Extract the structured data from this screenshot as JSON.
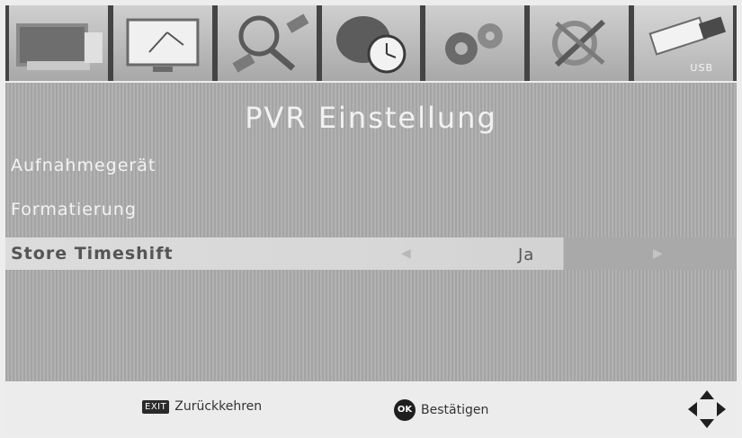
{
  "menu": {
    "title": "PVR Einstellung",
    "items": [
      {
        "label": "Aufnahmegerät"
      },
      {
        "label": "Formatierung"
      },
      {
        "label": "Store Timeshift",
        "value": "Ja",
        "selected": true
      }
    ]
  },
  "icon_bar": {
    "tiles": [
      {
        "icon": "tv-icon"
      },
      {
        "icon": "picture-icon"
      },
      {
        "icon": "satellite-search-icon"
      },
      {
        "icon": "globe-clock-icon"
      },
      {
        "icon": "gears-icon"
      },
      {
        "icon": "tools-icon"
      },
      {
        "icon": "usb-icon",
        "label": "USB"
      }
    ]
  },
  "help": {
    "exit_key": "EXIT",
    "back_label": "Zurückkehren",
    "ok_key": "OK",
    "confirm_label": "Bestätigen"
  },
  "colors": {
    "panel_bg": "#aaaaaa",
    "highlight_bg": "#d9d9d9",
    "text_light": "#f2f2f2",
    "text_dark": "#555555"
  }
}
